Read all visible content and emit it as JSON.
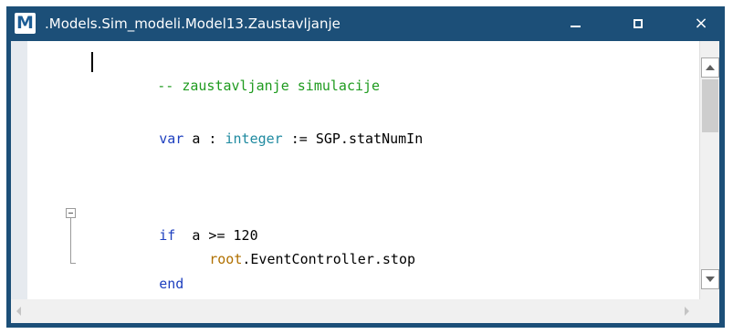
{
  "window": {
    "title": ".Models.Sim_modeli.Model13.Zaustavljanje",
    "app_icon_letter": "M",
    "minimize_icon": "minimize-icon",
    "maximize_icon": "maximize-icon",
    "close_glyph": "×"
  },
  "colors": {
    "titlebar": "#1c4f78",
    "comment": "#1f9b1f",
    "keyword": "#1d3fbf",
    "type": "#1f8aa0",
    "reference": "#b07000"
  },
  "code": {
    "line1": {
      "comment": "-- zaustavljanje simulacije"
    },
    "line2": {
      "kw_var": "var",
      "name_a": " a : ",
      "type": "integer",
      "rest": " := SGP.statNumIn"
    },
    "line3": {
      "kw_if": "if",
      "cond": "  a >= 120"
    },
    "line4": {
      "ref": "root",
      "rest": ".EventController.stop"
    },
    "line5": {
      "kw_end": "end"
    }
  }
}
